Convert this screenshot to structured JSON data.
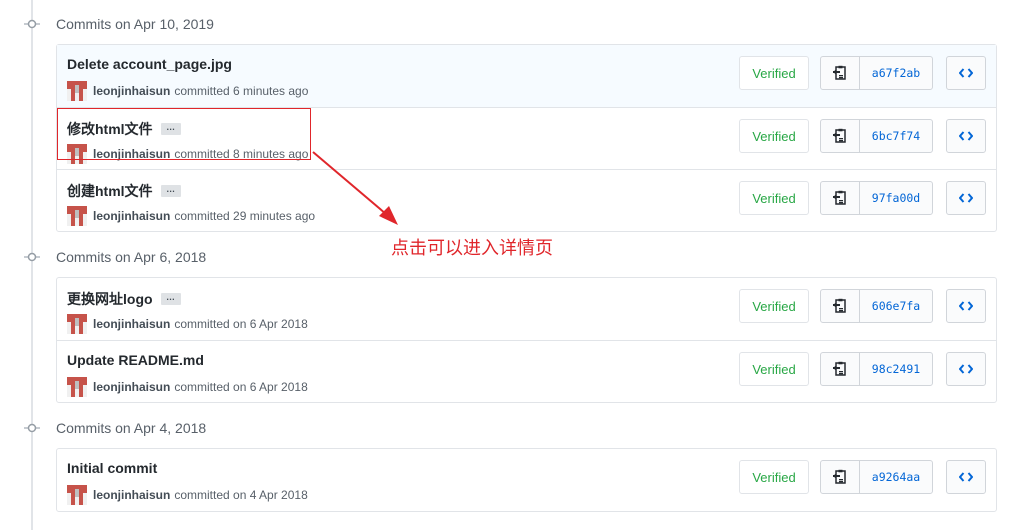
{
  "groups": [
    {
      "title": "Commits on Apr 10, 2019",
      "commits": [
        {
          "message": "Delete account_page.jpg",
          "has_ellipsis": false,
          "author": "leonjinhaisun",
          "time_text": "committed 6 minutes ago",
          "verified": "Verified",
          "sha": "a67f2ab",
          "highlight": true
        },
        {
          "message": "修改html文件",
          "has_ellipsis": true,
          "author": "leonjinhaisun",
          "time_text": "committed 8 minutes ago",
          "verified": "Verified",
          "sha": "6bc7f74",
          "highlight": false
        },
        {
          "message": "创建html文件",
          "has_ellipsis": true,
          "author": "leonjinhaisun",
          "time_text": "committed 29 minutes ago",
          "verified": "Verified",
          "sha": "97fa00d",
          "highlight": false
        }
      ]
    },
    {
      "title": "Commits on Apr 6, 2018",
      "commits": [
        {
          "message": "更换网址logo",
          "has_ellipsis": true,
          "author": "leonjinhaisun",
          "time_text": "committed on 6 Apr 2018",
          "verified": "Verified",
          "sha": "606e7fa",
          "highlight": false
        },
        {
          "message": "Update README.md",
          "has_ellipsis": false,
          "author": "leonjinhaisun",
          "time_text": "committed on 6 Apr 2018",
          "verified": "Verified",
          "sha": "98c2491",
          "highlight": false
        }
      ]
    },
    {
      "title": "Commits on Apr 4, 2018",
      "commits": [
        {
          "message": "Initial commit",
          "has_ellipsis": false,
          "author": "leonjinhaisun",
          "time_text": "committed on 4 Apr 2018",
          "verified": "Verified",
          "sha": "a9264aa",
          "highlight": false
        }
      ]
    }
  ],
  "ellipsis_label": "…",
  "annotation": {
    "text": "点击可以进入详情页",
    "color": "#e0262b"
  },
  "colors": {
    "verified": "#28a745",
    "sha_link": "#0366d6",
    "avatar_red": "#c6534a",
    "avatar_gray": "#bfbfbf"
  },
  "icons": {
    "timeline_node": "git-commit-icon",
    "copy": "clippy-icon",
    "browse": "code-icon",
    "avatar": "identicon-avatar"
  }
}
